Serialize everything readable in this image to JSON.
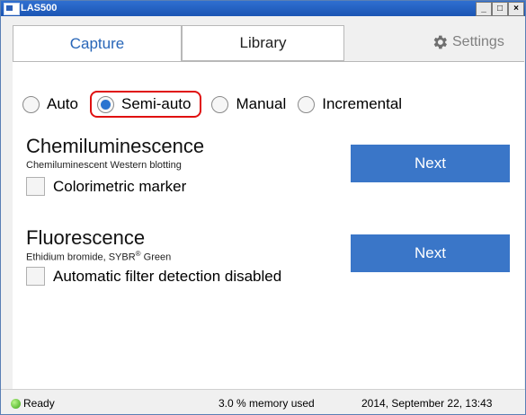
{
  "window": {
    "title": "LAS500",
    "min_label": "_",
    "max_label": "□",
    "close_label": "×"
  },
  "tabs": [
    {
      "label": "Capture",
      "active": true
    },
    {
      "label": "Library",
      "active": false
    }
  ],
  "settings_label": "Settings",
  "modes": [
    {
      "label": "Auto",
      "checked": false
    },
    {
      "label": "Semi-auto",
      "checked": true
    },
    {
      "label": "Manual",
      "checked": false
    },
    {
      "label": "Incremental",
      "checked": false
    }
  ],
  "chemi": {
    "title": "Chemiluminescence",
    "subtitle": "Chemiluminescent Western blotting",
    "checkbox_label": "Colorimetric marker",
    "next_label": "Next"
  },
  "fluor": {
    "title": "Fluorescence",
    "subtitle_pre": "Ethidium bromide, SYBR",
    "subtitle_sup": "®",
    "subtitle_post": " Green",
    "checkbox_label": "Automatic filter detection disabled",
    "next_label": "Next"
  },
  "status": {
    "state": "Ready",
    "memory": "3.0 % memory used",
    "datetime": "2014, September 22, 13:43"
  },
  "colors": {
    "accent": "#3a76c8",
    "highlight": "#e01010",
    "tab_active_text": "#2866b8"
  }
}
